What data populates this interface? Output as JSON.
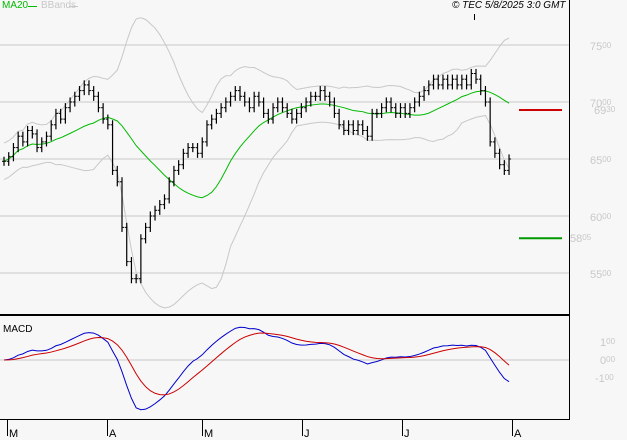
{
  "header": {
    "ma_label": "MA20",
    "bbands_label": "BBands",
    "copyright": "© TEC 5/8/2025 3:0 GMT"
  },
  "colors": {
    "ma": "#00bb00",
    "bbands": "#c8c8c8",
    "macd": "#0000cc",
    "signal": "#cc0000",
    "last_ma": "#cc0000",
    "support": "#009900"
  },
  "chart_data": {
    "type": "ohlc",
    "title": "",
    "price_axis": {
      "ticks": [
        [
          "75",
          "00"
        ],
        [
          "70",
          "00"
        ],
        [
          "65",
          "00"
        ],
        [
          "60",
          "00"
        ],
        [
          "55",
          "00"
        ]
      ],
      "values": [
        75,
        70,
        65,
        60,
        55
      ],
      "ylim": [
        52.8,
        77.5
      ]
    },
    "markers": [
      {
        "label_main": "69",
        "label_dec": "30",
        "value": 69.3,
        "color": "#cc0000"
      },
      {
        "label_main": "58",
        "label_dec": "05",
        "value": 58.05,
        "color": "#009900"
      }
    ],
    "months": [
      "M",
      "A",
      "M",
      "J",
      "J",
      "A"
    ],
    "month_index": [
      0,
      22,
      42,
      63,
      84,
      108
    ],
    "close": [
      64.8,
      65.2,
      66.0,
      67.0,
      66.5,
      67.5,
      67.2,
      66.0,
      66.5,
      67.0,
      68.0,
      69.0,
      68.5,
      69.5,
      70.0,
      70.5,
      71.0,
      71.5,
      71.0,
      70.5,
      69.5,
      68.5,
      68.0,
      64.0,
      63.0,
      59.0,
      56.0,
      54.5,
      54.5,
      58.0,
      59.0,
      60.0,
      60.5,
      61.0,
      61.5,
      63.0,
      64.0,
      64.5,
      65.5,
      66.0,
      66.0,
      65.5,
      66.5,
      68.0,
      68.5,
      69.0,
      69.5,
      70.0,
      70.5,
      71.0,
      70.5,
      70.0,
      69.5,
      70.5,
      70.0,
      69.0,
      68.5,
      69.5,
      70.0,
      69.5,
      69.0,
      68.5,
      69.0,
      69.5,
      70.0,
      70.5,
      70.5,
      71.0,
      70.5,
      70.0,
      69.0,
      68.0,
      67.5,
      68.0,
      67.5,
      68.0,
      67.5,
      67.0,
      69.0,
      69.0,
      69.5,
      70.0,
      69.5,
      69.0,
      69.5,
      69.0,
      69.5,
      70.0,
      70.5,
      71.0,
      71.5,
      72.0,
      71.5,
      72.0,
      71.5,
      72.0,
      71.5,
      72.0,
      71.5,
      72.5,
      72.0,
      71.0,
      70.0,
      66.5,
      65.5,
      64.5,
      64.0,
      65.0
    ],
    "macd_panel": {
      "label": "MACD",
      "ticks": [
        [
          "1",
          "00"
        ],
        [
          "0",
          "00"
        ],
        [
          "-1",
          "00"
        ]
      ],
      "values": [
        1,
        0,
        -1
      ]
    }
  }
}
